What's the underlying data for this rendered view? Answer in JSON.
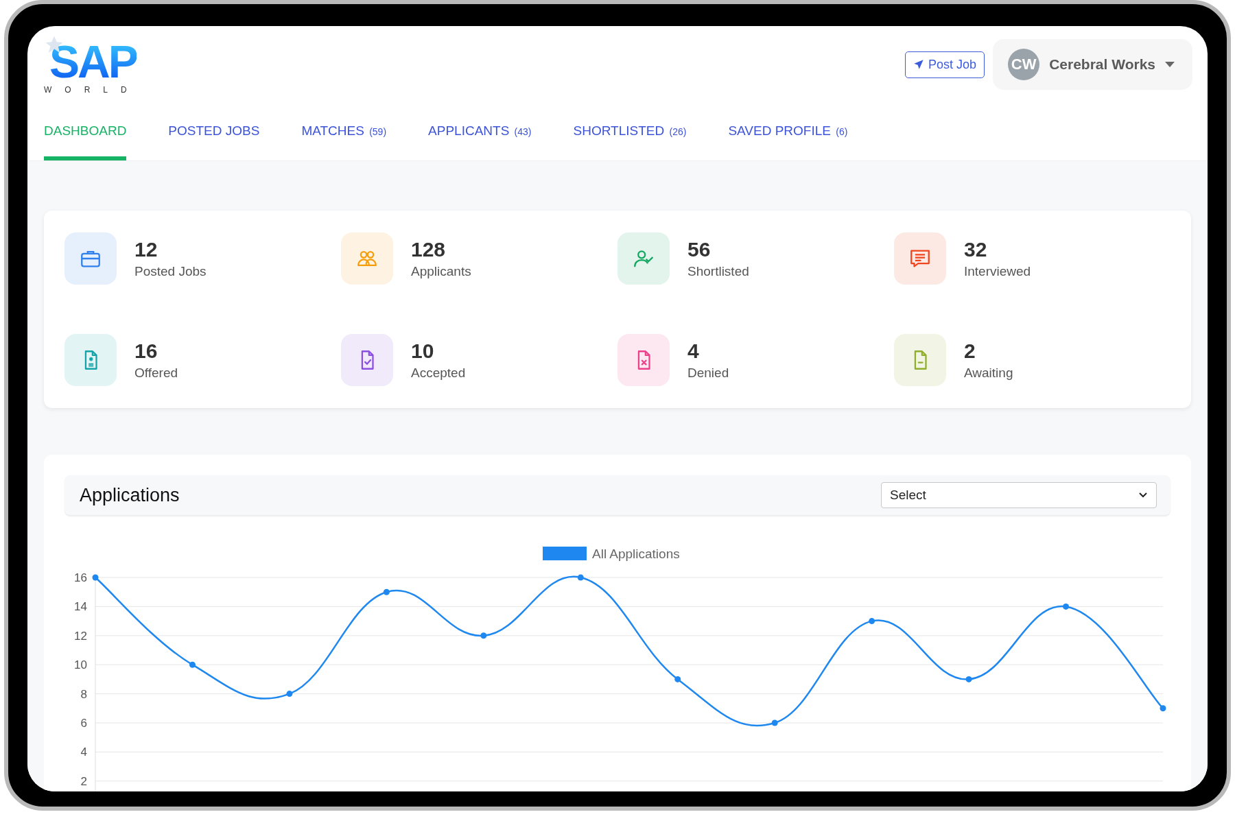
{
  "logo": {
    "title": "SAP",
    "subtitle": "WORLD"
  },
  "header": {
    "post_button": "Post Job",
    "profile": {
      "initials": "CW",
      "name": "Cerebral Works"
    }
  },
  "tabs": [
    {
      "label": "DASHBOARD",
      "selected": true
    },
    {
      "label": "POSTED JOBS",
      "selected": false
    },
    {
      "label": "MATCHES",
      "count": "(59)",
      "selected": false
    },
    {
      "label": "APPLICANTS",
      "count": "(43)",
      "selected": false
    },
    {
      "label": "SHORTLISTED",
      "count": "(26)",
      "selected": false
    },
    {
      "label": "SAVED PROFILE",
      "count": "(6)",
      "selected": false
    }
  ],
  "stats": [
    {
      "value": "12",
      "label": "Posted Jobs",
      "kind": "briefcase",
      "color": "#2f80ed"
    },
    {
      "value": "128",
      "label": "Applicants",
      "kind": "users",
      "color": "#f59e0b"
    },
    {
      "value": "56",
      "label": "Shortlisted",
      "kind": "user-check",
      "color": "#10a760"
    },
    {
      "value": "32",
      "label": "Interviewed",
      "kind": "message",
      "color": "#f0441d"
    },
    {
      "value": "16",
      "label": "Offered",
      "kind": "file-star",
      "color": "#14a3a8"
    },
    {
      "value": "10",
      "label": "Accepted",
      "kind": "file-check",
      "color": "#8b4fe0"
    },
    {
      "value": "4",
      "label": "Denied",
      "kind": "file-x",
      "color": "#ec3f8c"
    },
    {
      "value": "2",
      "label": "Awaiting",
      "kind": "file-minus",
      "color": "#8fae2b"
    }
  ],
  "applications": {
    "title": "Applications",
    "select": {
      "value": "Select"
    },
    "chart_data": {
      "type": "line",
      "ylim": [
        0.5,
        16
      ],
      "yticks": [
        2,
        4,
        6,
        8,
        10,
        12,
        14,
        16
      ],
      "grid": true,
      "series": [
        {
          "name": "All Applications",
          "color": "#1e88f0",
          "marker": true,
          "values": [
            16,
            10,
            8,
            15,
            12,
            16,
            9,
            6,
            13,
            9,
            14,
            7
          ]
        }
      ]
    }
  }
}
